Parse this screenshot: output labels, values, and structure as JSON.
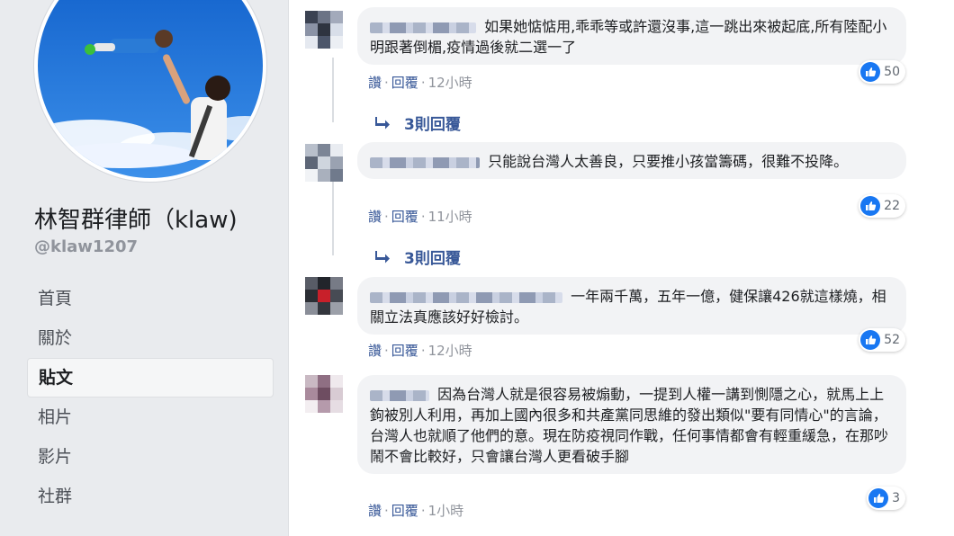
{
  "page": {
    "name": "林智群律師（klaw)",
    "handle": "@klaw1207"
  },
  "nav": {
    "items": [
      {
        "label": "首頁"
      },
      {
        "label": "關於"
      },
      {
        "label": "貼文"
      },
      {
        "label": "相片"
      },
      {
        "label": "影片"
      },
      {
        "label": "社群"
      }
    ],
    "active": "貼文"
  },
  "comments": [
    {
      "text": "如果她惦惦用,乖乖等或許還沒事,這一跳出來被起底,所有陸配小明跟著倒楣,疫情過後就二選一了",
      "likes": "50",
      "read": "讚",
      "reply": "回覆",
      "time": "12小時",
      "replies": "3則回覆"
    },
    {
      "text": "只能說台灣人太善良，只要推小孩當籌碼，很難不投降。",
      "likes": "22",
      "read": "讚",
      "reply": "回覆",
      "time": "11小時",
      "replies": "3則回覆"
    },
    {
      "text": "一年兩千萬，五年一億，健保讓426就這樣燒，相關立法真應該好好檢討。",
      "likes": "52",
      "read": "讚",
      "reply": "回覆",
      "time": "12小時"
    },
    {
      "text": "因為台灣人就是很容易被煽動，一提到人權一講到惻隱之心，就馬上上鉤被別人利用，再加上國內很多和共產黨同思維的發出類似\"要有同情心\"的言論，台灣人也就順了他們的意。現在防疫視同作戰，任何事情都會有輕重緩急，在那吵鬧不會比較好，只會讓台灣人更看破手腳",
      "likes": "3",
      "read": "讚",
      "reply": "回覆",
      "time": "1小時"
    }
  ],
  "colors": {
    "link": "#385898",
    "like_blue": "#1877f2",
    "bubble": "#f2f3f5",
    "sidebar_bg": "#e9ebee"
  },
  "icons": [
    "like-thumb-icon",
    "reply-arrow-icon"
  ]
}
